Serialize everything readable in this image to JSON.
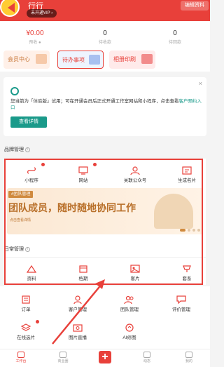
{
  "header": {
    "username": "行行",
    "vip_badge": "未开通VIP ›",
    "edit_button": "编辑资料"
  },
  "stats": [
    {
      "value": "¥0.00",
      "label": "预收 ●",
      "red": true
    },
    {
      "value": "0",
      "label": "待收款"
    },
    {
      "value": "0",
      "label": "待回款"
    }
  ],
  "quick_cards": [
    "会员中心",
    "待办事项",
    "相册印刷"
  ],
  "notice": {
    "close": "×",
    "text_prefix": "您当前为「体验版」试用；可在开通会员后正式开通工作室网站和小程序，点击查看",
    "link_text": "客户预约入口",
    "button": "查看详情"
  },
  "brand_section": {
    "title": "品牌管理",
    "items": [
      {
        "label": "小程序",
        "icon": "mini-program-icon",
        "badge": true
      },
      {
        "label": "网站",
        "icon": "website-icon",
        "badge": true
      },
      {
        "label": "关联公众号",
        "icon": "official-account-icon",
        "badge": false
      },
      {
        "label": "生成名片",
        "icon": "business-card-icon",
        "badge": false
      }
    ]
  },
  "banner": {
    "tag": "#团队管理",
    "title": "团队成员，随时随地协同工作",
    "subtitle": "点击查看详情"
  },
  "daily_section": {
    "title": "日常管理",
    "items": [
      {
        "label": "资料",
        "icon": "materials-icon"
      },
      {
        "label": "档期",
        "icon": "schedule-icon"
      },
      {
        "label": "客片",
        "icon": "client-photos-icon"
      },
      {
        "label": "套系",
        "icon": "package-icon"
      }
    ]
  },
  "more_items_row1": [
    {
      "label": "订单",
      "icon": "order-icon"
    },
    {
      "label": "客户管理",
      "icon": "customer-icon"
    },
    {
      "label": "团队管理",
      "icon": "team-icon"
    },
    {
      "label": "评价管理",
      "icon": "review-icon"
    }
  ],
  "more_items_row2": [
    {
      "label": "在线选片",
      "icon": "photo-select-icon",
      "badge": true
    },
    {
      "label": "图片直播",
      "icon": "live-photo-icon"
    },
    {
      "label": "AI修图",
      "icon": "ai-retouch-icon"
    }
  ],
  "bottom_nav": [
    {
      "label": "工作台",
      "icon": "workbench-icon",
      "active": true
    },
    {
      "label": "商业圈",
      "icon": "business-icon"
    },
    {
      "label": "",
      "icon": "plus-icon"
    },
    {
      "label": "动态",
      "icon": "feed-icon"
    },
    {
      "label": "我的",
      "icon": "profile-icon"
    }
  ],
  "colors": {
    "accent": "#e8403a",
    "teal": "#1a9a8a",
    "banner": "#b9702a"
  }
}
